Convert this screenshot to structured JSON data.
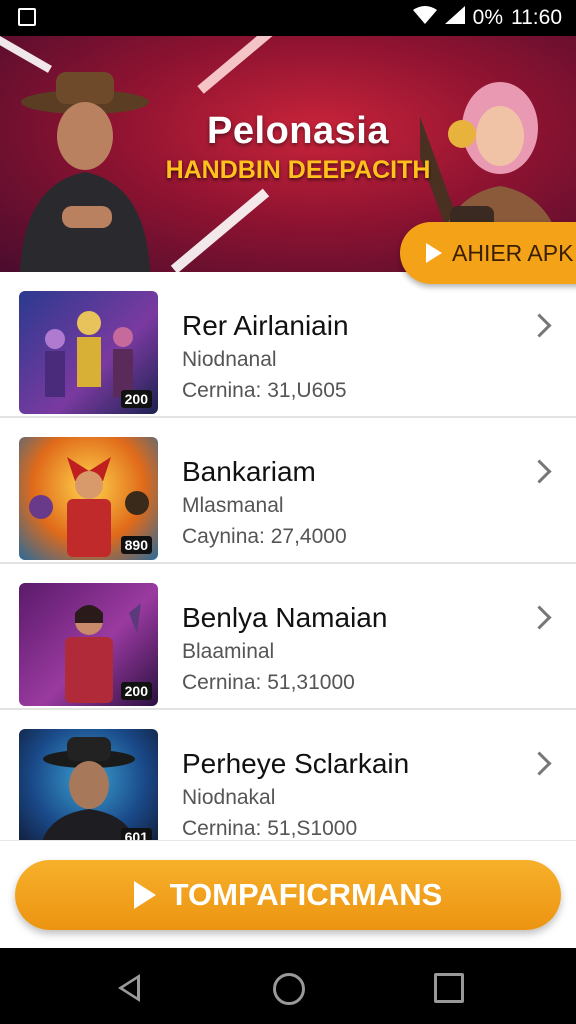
{
  "status_bar": {
    "battery": "0%",
    "time": "11:60"
  },
  "banner": {
    "title": "Pelonasia",
    "subtitle": "HANDBIN DEEPACITH",
    "button_label": "AHIER APK"
  },
  "games": [
    {
      "title": "Rer Airlaniain",
      "subtitle": "Niodnanal",
      "meta": "Cernina: 31,U605",
      "badge": "200"
    },
    {
      "title": "Bankariam",
      "subtitle": "Mlasmanal",
      "meta": "Caynina: 27,4000",
      "badge": "890"
    },
    {
      "title": "Benlya Namaian",
      "subtitle": "Blaaminal",
      "meta": "Cernina: 51,31000",
      "badge": "200"
    },
    {
      "title": "Perheye Sclarkain",
      "subtitle": "Niodnakal",
      "meta": "Cernina: 51,S1000",
      "badge": "601"
    }
  ],
  "cta": {
    "label": "TOMPAFICRMANS"
  },
  "colors": {
    "accent": "#f4a319",
    "banner": "#8f1331"
  }
}
